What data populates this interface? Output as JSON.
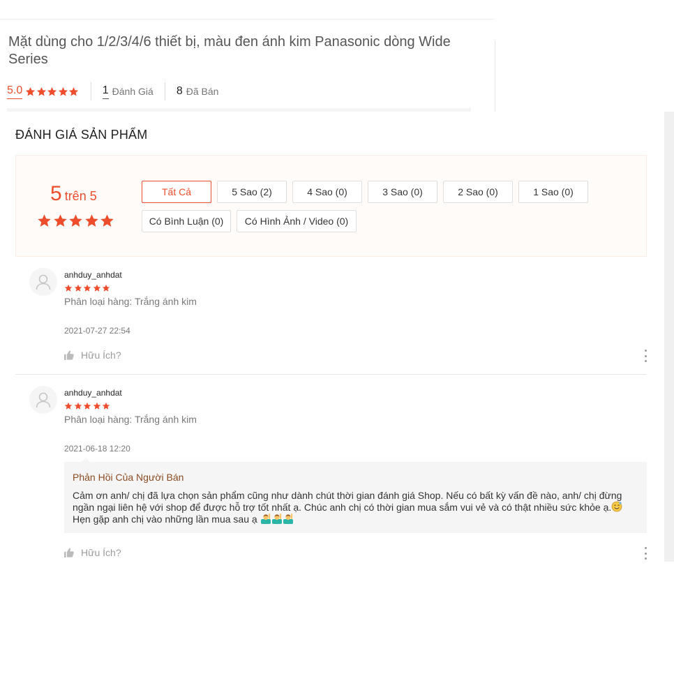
{
  "product": {
    "title": "Mặt dùng cho 1/2/3/4/6 thiết bị, màu đen ánh kim Panasonic dòng Wide Series",
    "rating": "5.0",
    "review_count": "1",
    "review_label": "Đánh Giá",
    "sold_count": "8",
    "sold_label": "Đã Bán"
  },
  "ratings_section": {
    "title": "ĐÁNH GIÁ SẢN PHẨM",
    "score": "5",
    "score_suffix": "trên 5",
    "filters": [
      "Tất Cả",
      "5 Sao (2)",
      "4 Sao (0)",
      "3 Sao (0)",
      "2 Sao (0)",
      "1 Sao (0)",
      "Có Bình Luận (0)",
      "Có Hình Ảnh / Video (0)"
    ],
    "active_filter": "Tất Cả"
  },
  "reviews": [
    {
      "author": "anhduy_anhdat",
      "stars": 5,
      "variation": "Phân loại hàng: Trắng ánh kim",
      "date": "2021-07-27 22:54",
      "helpful": "Hữu Ích?"
    },
    {
      "author": "anhduy_anhdat",
      "stars": 5,
      "variation": "Phân loại hàng: Trắng ánh kim",
      "date": "2021-06-18 12:20",
      "helpful": "Hữu Ích?",
      "seller_reply": {
        "title": "Phản Hồi Của Người Bán",
        "line1": "Cảm ơn anh/ chị đã lựa chọn sản phẩm cũng như dành chút thời gian đánh giá Shop. Nếu có bất kỳ vấn đề nào, anh/ chị đừng",
        "line2": "ngần ngại liên hệ với shop để được hỗ trợ tốt nhất ạ. Chúc anh chị có thời gian mua sắm vui vẻ và có thật nhiều sức khỏe ạ.",
        "line3": "Hẹn gặp anh chị vào những lần mua sau ạ"
      }
    }
  ],
  "colors": {
    "accent": "#ee4d2d",
    "reply_title": "#8b4a21",
    "overview_bg": "#fffbf8"
  },
  "icons": [
    "star-icon",
    "avatar-placeholder-icon",
    "thumbs-up-icon",
    "more-vertical-icon",
    "smile-emoji-icon",
    "person-raising-hand-emoji-icon"
  ]
}
